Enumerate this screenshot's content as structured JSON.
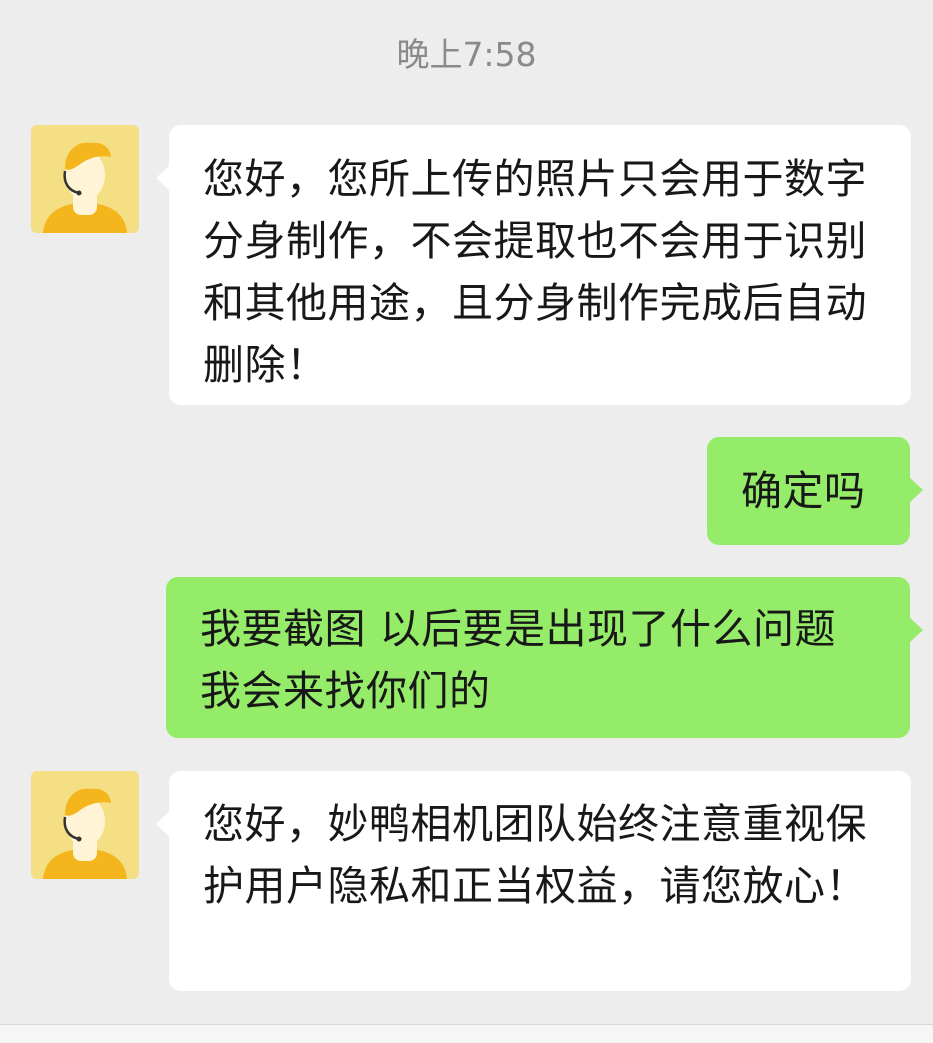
{
  "chat": {
    "timestamp": "晚上7:58",
    "messages": [
      {
        "sender": "agent",
        "text": "您好，您所上传的照片只会用于数字分身制作，不会提取也不会用于识别和其他用途，且分身制作完成后自动删除！"
      },
      {
        "sender": "me",
        "text": "确定吗"
      },
      {
        "sender": "me",
        "text": "我要截图 以后要是出现了什么问题 我会来找你们的"
      },
      {
        "sender": "agent",
        "text": "您好，妙鸭相机团队始终注意重视保护用户隐私和正当权益，请您放心！"
      }
    ]
  },
  "colors": {
    "background": "#ededed",
    "incoming_bubble": "#ffffff",
    "outgoing_bubble": "#95ec69",
    "avatar_background": "#f4df85",
    "avatar_accent": "#f5b51c",
    "timestamp_text": "#8a8a8a"
  },
  "icons": {
    "agent_avatar": "customer-service-headset-avatar"
  }
}
